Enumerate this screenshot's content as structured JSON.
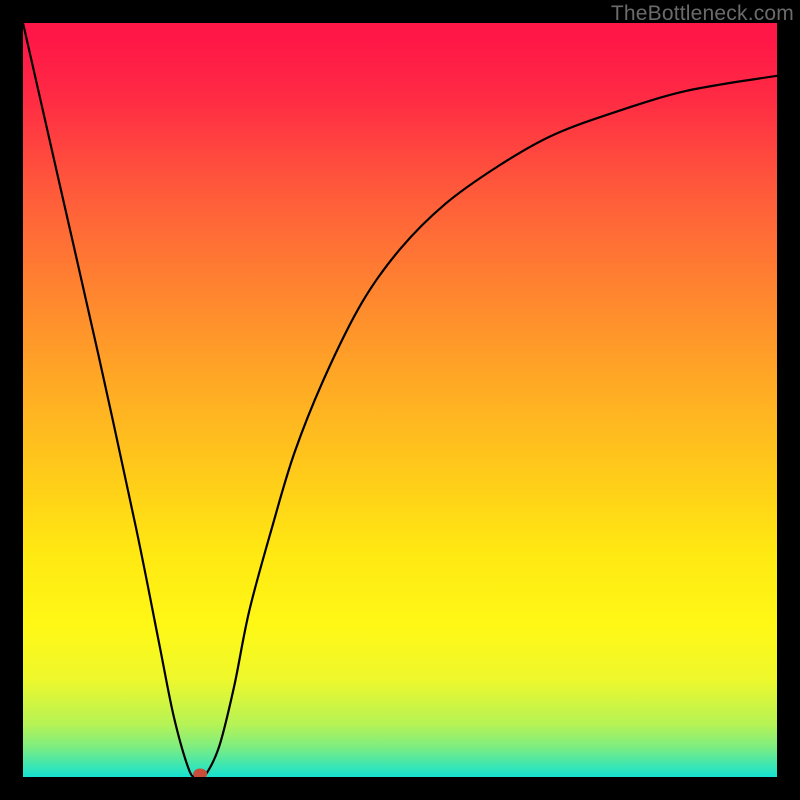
{
  "watermark": "TheBottleneck.com",
  "chart_data": {
    "type": "line",
    "title": "",
    "xlabel": "",
    "ylabel": "",
    "xlim": [
      0,
      100
    ],
    "ylim": [
      0,
      100
    ],
    "grid": false,
    "legend": false,
    "series": [
      {
        "name": "bottleneck-curve",
        "x": [
          0,
          5,
          10,
          15,
          18,
          20,
          22,
          23,
          24,
          26,
          28,
          30,
          33,
          36,
          40,
          45,
          50,
          56,
          63,
          70,
          78,
          88,
          100
        ],
        "y": [
          100,
          78,
          56,
          33,
          18,
          8,
          1,
          0,
          0,
          4,
          12,
          22,
          33,
          43,
          53,
          63,
          70,
          76,
          81,
          85,
          88,
          91,
          93
        ]
      }
    ],
    "marker": {
      "x": 23.5,
      "y": 0,
      "color": "#c94d3b"
    },
    "background_gradient": {
      "top": "#ff1747",
      "middle": "#ffd118",
      "bottom": "#16e2d3"
    }
  }
}
